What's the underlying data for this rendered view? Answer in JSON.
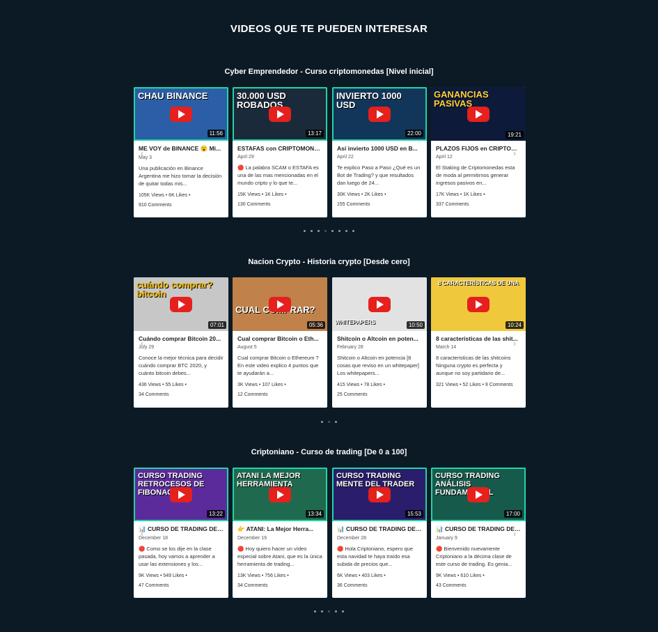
{
  "page_title": "VIDEOS QUE TE PUEDEN INTERESAR",
  "sections": [
    {
      "title": "Cyber Emprendedor - Curso criptomonedas [Nivel inicial]",
      "cards": [
        {
          "thumb_text": "CHAU BINANCE",
          "duration": "11:56",
          "title": "ME VOY de BINANCE 😮 Mi...",
          "date": "May 3",
          "desc": "Una publicación en Binance Argentina me hizo tomar la decisión de quitar todas mis...",
          "stats": "105K Views • 6K Likes •",
          "comments": "910 Comments"
        },
        {
          "thumb_text": "30.000 USD ROBADOS",
          "duration": "13:17",
          "title": "ESTAFAS con CRIPTOMONE...",
          "date": "April 29",
          "desc": "🔴 La palabra SCAM o ESTAFA es una de las mas mencionadas en el mundo cripto y lo que te...",
          "stats": "15K Views • 1K Likes •",
          "comments": "130 Comments"
        },
        {
          "thumb_text": "INVIERTO 1000 USD",
          "duration": "22:00",
          "title": "Así invierto 1000 USD en B...",
          "date": "April 22",
          "desc": "Te explico Paso a Paso ¿Qué es un Bot de Trading? y que resultados dan luego de 24...",
          "stats": "30K Views • 2K Likes •",
          "comments": "155 Comments"
        },
        {
          "thumb_text": "GANANCIAS PASIVAS",
          "duration": "19:21",
          "title": "PLAZOS FIJOS en CRIPTOM...",
          "date": "April 12",
          "desc": "El Staking de Criptomonedas esta de moda al permitirnos generar ingresos pasivos en...",
          "stats": "17K Views • 1K Likes •",
          "comments": "337 Comments"
        }
      ],
      "dots": 8,
      "active_dot": 4
    },
    {
      "title": "Nacion Crypto - Historia crypto [Desde cero]",
      "cards": [
        {
          "thumb_text": "cuándo comprar? bitcoin",
          "duration": "07:01",
          "title": "Cuándo comprar Bitcoin 20...",
          "date": "July 29",
          "desc": "Conoce la mejor técnica para decidir cuándo comprar BTC 2020, y cuánto bitcoin debes...",
          "stats": "436 Views • 55 Likes •",
          "comments": "34 Comments"
        },
        {
          "thumb_text": "CUAL COMPRAR?",
          "duration": "05:36",
          "title": "Cual comprar Bitcoin o Eth...",
          "date": "August 5",
          "desc": "Cual comprar Bitcoin o Ethereum ?En este video explico 4 puntos que te ayudarán a...",
          "stats": "3K Views • 107 Likes •",
          "comments": "12 Comments"
        },
        {
          "thumb_text": "WHITEPAPERS",
          "duration": "10:50",
          "title": "Shitcoin o Altcoin en poten...",
          "date": "February 28",
          "desc": "Shitcoin o Altcoin en potencia [8 cosas que reviso en un whitepaper] Los whitepapers...",
          "stats": "415 Views • 78 Likes •",
          "comments": "25 Comments"
        },
        {
          "thumb_text": "8 CARACTERÍSTICAS DE UNA",
          "duration": "10:24",
          "title": "8 caracteristicas de las shit...",
          "date": "March 14",
          "desc": "8 caracteristicas de las shitcoins Ninguna crypto es perfecta y aunque no soy partidario de...",
          "stats": "321 Views • 52 Likes • 9 Comments",
          "comments": ""
        }
      ],
      "dots": 3,
      "active_dot": 1
    },
    {
      "title": "Criptoniano - Curso de trading [De 0 a 100]",
      "cards": [
        {
          "thumb_text": "CURSO TRADING RETROCESOS DE FIBONACCI",
          "duration": "13:22",
          "title": "📊 CURSO DE TRADING DE ...",
          "date": "December 18",
          "desc": "🔴 Como se los dije en la clase pasada, hoy vamos a aprender a usar las extensiones y los...",
          "stats": "9K Views • 549 Likes •",
          "comments": "47 Comments"
        },
        {
          "thumb_text": "ATANI LA MEJOR HERRAMIENTA",
          "duration": "13:34",
          "title": "👉 ATANI: La Mejor Herra...",
          "date": "December 19",
          "desc": "🔴 Hoy quiero hacer un vídeo especial sobre Atani, que es la única herramienta de trading...",
          "stats": "13K Views • 756 Likes •",
          "comments": "34 Comments"
        },
        {
          "thumb_text": "CURSO TRADING MENTE DEL TRADER",
          "duration": "15:53",
          "title": "📊 CURSO DE TRADING DE ...",
          "date": "December 28",
          "desc": "🔴 Hola Criptoniano, espero que esta navidad te haya traído esa subida de precios que...",
          "stats": "6K Views • 403 Likes •",
          "comments": "36 Comments"
        },
        {
          "thumb_text": "CURSO TRADING ANÁLISIS FUNDAMENTAL",
          "duration": "17:00",
          "title": "📊 CURSO DE TRADING DE ...",
          "date": "January 9",
          "desc": "🔴 Bienvenido nuevamente Criptoniano a la décima clase de este curso de trading. Es genia...",
          "stats": "9K Views • 610 Likes •",
          "comments": "43 Comments"
        }
      ],
      "dots": 5,
      "active_dot": 3
    }
  ]
}
